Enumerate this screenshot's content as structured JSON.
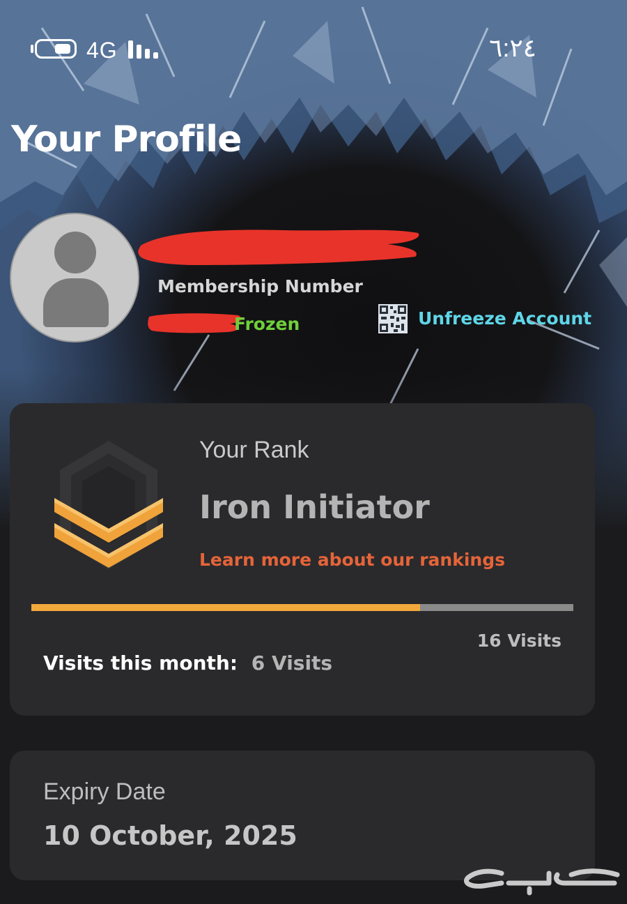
{
  "status_bar": {
    "network": "4G",
    "time": "٦:٢٤"
  },
  "page_title": "Your Profile",
  "profile": {
    "membership_label": "Membership Number",
    "status_text": "Frozen",
    "status_color": "#6fd03a",
    "unfreeze_label": "Unfreeze Account",
    "unfreeze_color": "#5fd6e8"
  },
  "rank": {
    "label": "Your Rank",
    "name": "Iron Initiator",
    "learn_more": "Learn more about our rankings",
    "progress_fraction": 0.717,
    "goal_visits": "16 Visits",
    "visits_label": "Visits this month:",
    "visits_value": "6 Visits",
    "accent_color": "#f2a93b",
    "link_color": "#e5643a"
  },
  "expiry": {
    "label": "Expiry Date",
    "value": "10 October, 2025"
  },
  "watermark_text": "حراج"
}
